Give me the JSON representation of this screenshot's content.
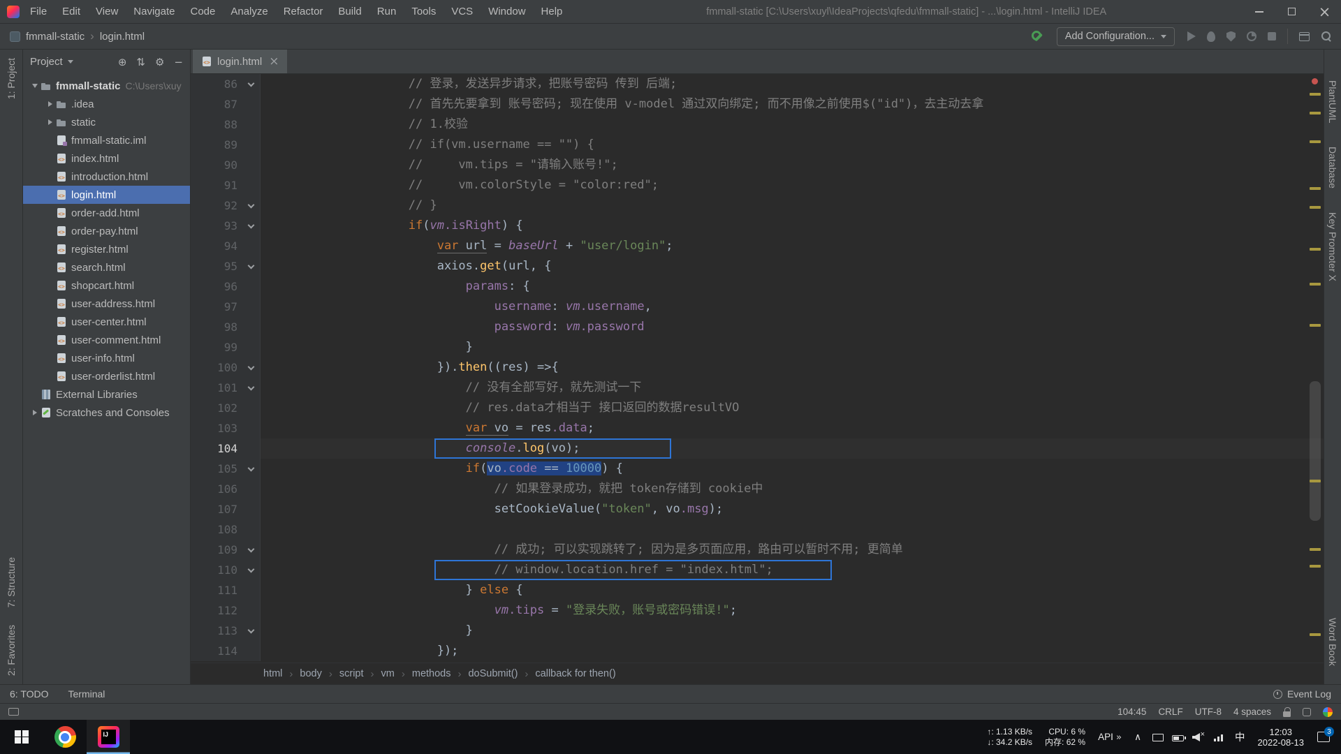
{
  "colors": {
    "accent_selection": "#4B6EAF",
    "annotation_blue": "#2E75D6",
    "keyword": "#CC7832",
    "string": "#6A8759",
    "number": "#6897BB",
    "comment": "#7F7F7F",
    "function": "#FFC66B",
    "global_var": "#9876AA"
  },
  "titlebar": {
    "menus": [
      "File",
      "Edit",
      "View",
      "Navigate",
      "Code",
      "Analyze",
      "Refactor",
      "Build",
      "Run",
      "Tools",
      "VCS",
      "Window",
      "Help"
    ],
    "title": "fmmall-static [C:\\Users\\xuyl\\IdeaProjects\\qfedu\\fmmall-static] - ...\\login.html - IntelliJ IDEA"
  },
  "navbar": {
    "crumbs": [
      "fmmall-static",
      "login.html"
    ],
    "add_config": "Add Configuration..."
  },
  "left_stripe": {
    "top": "1: Project",
    "bottom": [
      "7: Structure",
      "2: Favorites"
    ]
  },
  "right_stripe": [
    "PlantUML",
    "Database",
    "Key Promoter X",
    "Word Book"
  ],
  "project": {
    "header": "Project",
    "items": [
      {
        "depth": 0,
        "arrow": "down",
        "icon": "folder",
        "label": "fmmall-static",
        "path": "C:\\Users\\xuy",
        "bold": true
      },
      {
        "depth": 1,
        "arrow": "right",
        "icon": "folder",
        "label": ".idea"
      },
      {
        "depth": 1,
        "arrow": "right",
        "icon": "folder",
        "label": "static"
      },
      {
        "depth": 1,
        "icon": "iml",
        "label": "fmmall-static.iml"
      },
      {
        "depth": 1,
        "icon": "html",
        "label": "index.html"
      },
      {
        "depth": 1,
        "icon": "html",
        "label": "introduction.html"
      },
      {
        "depth": 1,
        "icon": "html",
        "label": "login.html",
        "selected": true
      },
      {
        "depth": 1,
        "icon": "html",
        "label": "order-add.html"
      },
      {
        "depth": 1,
        "icon": "html",
        "label": "order-pay.html"
      },
      {
        "depth": 1,
        "icon": "html",
        "label": "register.html"
      },
      {
        "depth": 1,
        "icon": "html",
        "label": "search.html"
      },
      {
        "depth": 1,
        "icon": "html",
        "label": "shopcart.html"
      },
      {
        "depth": 1,
        "icon": "html",
        "label": "user-address.html"
      },
      {
        "depth": 1,
        "icon": "html",
        "label": "user-center.html"
      },
      {
        "depth": 1,
        "icon": "html",
        "label": "user-comment.html"
      },
      {
        "depth": 1,
        "icon": "html",
        "label": "user-info.html"
      },
      {
        "depth": 1,
        "icon": "html",
        "label": "user-orderlist.html"
      },
      {
        "depth": 0,
        "icon": "lib",
        "label": "External Libraries"
      },
      {
        "depth": 0,
        "arrow": "right",
        "icon": "scratch",
        "label": "Scratches and Consoles"
      }
    ]
  },
  "editor": {
    "tab": "login.html",
    "breadcrumbs": [
      "html",
      "body",
      "script",
      "vm",
      "methods",
      "doSubmit()",
      "callback for then()"
    ],
    "stripe_marks": [
      27,
      54,
      95,
      162,
      189,
      249,
      299,
      358,
      581,
      679,
      703,
      801
    ],
    "lines": [
      {
        "n": 86,
        "ind": 16,
        "fold": true,
        "toks": [
          [
            "c",
            "// 登录，发送异步请求，把账号密码 传到 后端;"
          ]
        ]
      },
      {
        "n": 87,
        "ind": 16,
        "toks": [
          [
            "c",
            "// 首先先要拿到 账号密码; 现在使用 v-model 通过双向绑定; 而不用像之前使用$(\"id\")，去主动去拿"
          ]
        ]
      },
      {
        "n": 88,
        "ind": 16,
        "toks": [
          [
            "c",
            "// 1.校验"
          ]
        ]
      },
      {
        "n": 89,
        "ind": 16,
        "toks": [
          [
            "c",
            "// if(vm.username == \"\") {"
          ]
        ]
      },
      {
        "n": 90,
        "ind": 16,
        "toks": [
          [
            "c",
            "//     vm.tips = \"请输入账号!\";"
          ]
        ]
      },
      {
        "n": 91,
        "ind": 16,
        "toks": [
          [
            "c",
            "//     vm.colorStyle = \"color:red\";"
          ]
        ]
      },
      {
        "n": 92,
        "ind": 16,
        "fold": true,
        "toks": [
          [
            "c",
            "// }"
          ]
        ]
      },
      {
        "n": 93,
        "ind": 16,
        "fold": true,
        "toks": [
          [
            "k",
            "if"
          ],
          [
            "t",
            "("
          ],
          [
            "g",
            "vm"
          ],
          [
            "p",
            ".isRight"
          ],
          [
            "t",
            ") {"
          ]
        ]
      },
      {
        "n": 94,
        "ind": 20,
        "toks": [
          [
            "k u",
            "var"
          ],
          [
            "t u",
            " url"
          ],
          [
            "t",
            " = "
          ],
          [
            "g",
            "baseUrl"
          ],
          [
            "t",
            " + "
          ],
          [
            "s",
            "\"user/login\""
          ],
          [
            "t",
            ";"
          ]
        ]
      },
      {
        "n": 95,
        "ind": 20,
        "fold": true,
        "toks": [
          [
            "t",
            "axios."
          ],
          [
            "f",
            "get"
          ],
          [
            "t",
            "(url, {"
          ]
        ]
      },
      {
        "n": 96,
        "ind": 24,
        "toks": [
          [
            "p",
            "params"
          ],
          [
            "t",
            ": {"
          ]
        ]
      },
      {
        "n": 97,
        "ind": 28,
        "toks": [
          [
            "p",
            "username"
          ],
          [
            "t",
            ": "
          ],
          [
            "g",
            "vm"
          ],
          [
            "p",
            ".username"
          ],
          [
            "t",
            ","
          ]
        ]
      },
      {
        "n": 98,
        "ind": 28,
        "toks": [
          [
            "p",
            "password"
          ],
          [
            "t",
            ": "
          ],
          [
            "g",
            "vm"
          ],
          [
            "p",
            ".password"
          ]
        ]
      },
      {
        "n": 99,
        "ind": 24,
        "toks": [
          [
            "t",
            "}"
          ]
        ]
      },
      {
        "n": 100,
        "ind": 20,
        "fold": true,
        "toks": [
          [
            "t",
            "})."
          ],
          [
            "f",
            "then"
          ],
          [
            "t",
            "((res) =>{"
          ]
        ]
      },
      {
        "n": 101,
        "ind": 24,
        "fold": true,
        "toks": [
          [
            "c",
            "// 没有全部写好，就先测试一下"
          ]
        ]
      },
      {
        "n": 102,
        "ind": 24,
        "toks": [
          [
            "c",
            "// res.data才相当于 接口返回的数据resultVO"
          ]
        ]
      },
      {
        "n": 103,
        "ind": 24,
        "toks": [
          [
            "k u",
            "var"
          ],
          [
            "t u",
            " vo"
          ],
          [
            "t",
            " = res"
          ],
          [
            "p",
            ".data"
          ],
          [
            "t",
            ";"
          ]
        ]
      },
      {
        "n": 104,
        "ind": 24,
        "cur": true,
        "anno": 339,
        "toks": [
          [
            "g",
            "console"
          ],
          [
            "t",
            "."
          ],
          [
            "f",
            "log"
          ],
          [
            "t",
            "(vo);"
          ]
        ]
      },
      {
        "n": 105,
        "ind": 24,
        "fold": true,
        "toks": [
          [
            "k",
            "if"
          ],
          [
            "t",
            "("
          ],
          [
            "t sel",
            "vo"
          ],
          [
            "p sel",
            ".code"
          ],
          [
            "t sel",
            " == "
          ],
          [
            "n sel",
            "10000"
          ],
          [
            "t",
            ") {"
          ]
        ]
      },
      {
        "n": 106,
        "ind": 28,
        "toks": [
          [
            "c",
            "// 如果登录成功，就把 token存储到 cookie中"
          ]
        ]
      },
      {
        "n": 107,
        "ind": 28,
        "toks": [
          [
            "t",
            "setCookieValue("
          ],
          [
            "s",
            "\"token\""
          ],
          [
            "t",
            ", vo"
          ],
          [
            "p",
            ".msg"
          ],
          [
            "t",
            ");"
          ]
        ]
      },
      {
        "n": 108,
        "ind": 0,
        "toks": []
      },
      {
        "n": 109,
        "ind": 28,
        "fold": true,
        "toks": [
          [
            "c",
            "// 成功; 可以实现跳转了; 因为是多页面应用，路由可以暂时不用; 更简单"
          ]
        ]
      },
      {
        "n": 110,
        "ind": 28,
        "fold": true,
        "anno": 569,
        "toks": [
          [
            "c",
            "// window.location.href = \"index.html\";"
          ]
        ]
      },
      {
        "n": 111,
        "ind": 24,
        "toks": [
          [
            "t",
            "} "
          ],
          [
            "k",
            "else"
          ],
          [
            "t",
            " {"
          ]
        ]
      },
      {
        "n": 112,
        "ind": 28,
        "toks": [
          [
            "g",
            "vm"
          ],
          [
            "p",
            ".tips"
          ],
          [
            "t",
            " = "
          ],
          [
            "s",
            "\"登录失败，账号或密码错误!\""
          ],
          [
            "t",
            ";"
          ]
        ]
      },
      {
        "n": 113,
        "ind": 24,
        "fold": true,
        "toks": [
          [
            "t",
            "}"
          ]
        ]
      },
      {
        "n": 114,
        "ind": 20,
        "toks": [
          [
            "t",
            "});"
          ]
        ]
      }
    ]
  },
  "bottom": {
    "todo": "6: TODO",
    "terminal": "Terminal",
    "event_log": "Event Log"
  },
  "statusbar": {
    "caret": "104:45",
    "line_sep": "CRLF",
    "encoding": "UTF-8",
    "indent": "4 spaces"
  },
  "taskbar": {
    "net_up": "↑: 1.13 KB/s",
    "net_down": "↓: 34.2 KB/s",
    "cpu": "CPU: 6 %",
    "mem": "内存: 62 %",
    "api": "API",
    "expand": "»",
    "hidden": "∧",
    "ime": "中",
    "time": "12:03",
    "date": "2022-08-13",
    "badge": "3"
  }
}
